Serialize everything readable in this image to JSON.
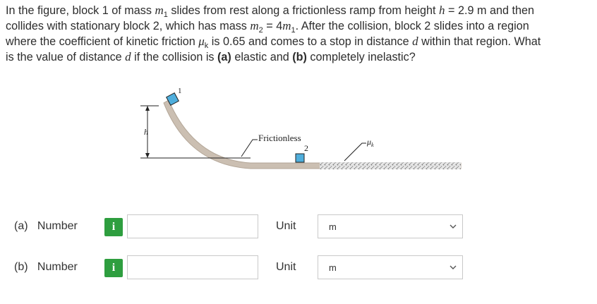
{
  "question": {
    "line1_a": "In the figure, block 1 of mass ",
    "m": "m",
    "sub1": "1",
    "line1_b": " slides from rest along a frictionless ramp from height ",
    "h": "h",
    "line1_c": " = 2.9 m and then",
    "line2_a": "collides with stationary block 2, which has mass ",
    "sub2": "2",
    "line2_b": " = 4",
    "line2_c": ". After the collision, block 2 slides into a region",
    "line3_a": "where the coefficient of kinetic friction ",
    "mu": "μ",
    "k": "k",
    "line3_b": " is 0.65 and comes to a stop in distance ",
    "d": "d",
    "line3_c": " within that region. What",
    "line4_a": "is the value of distance ",
    "line4_b": " if the collision is ",
    "part_a": "(a)",
    "line4_c": " elastic and ",
    "part_b": "(b)",
    "line4_d": " completely inelastic?"
  },
  "figure": {
    "block1_label": "1",
    "height_label": "h",
    "frictionless_label": "Frictionless",
    "block2_label": "2",
    "mu_label": "μ",
    "mu_sub": "k",
    "colors": {
      "ramp": "#cbbfb2",
      "ramp_edge": "#b3a697",
      "block": "#4faedc",
      "rough": "#9a9a9a"
    }
  },
  "answers": [
    {
      "part": "(a)",
      "number_label": "Number",
      "info_icon": "i",
      "value": "",
      "unit_label": "Unit",
      "unit_value": "m"
    },
    {
      "part": "(b)",
      "number_label": "Number",
      "info_icon": "i",
      "value": "",
      "unit_label": "Unit",
      "unit_value": "m"
    }
  ]
}
